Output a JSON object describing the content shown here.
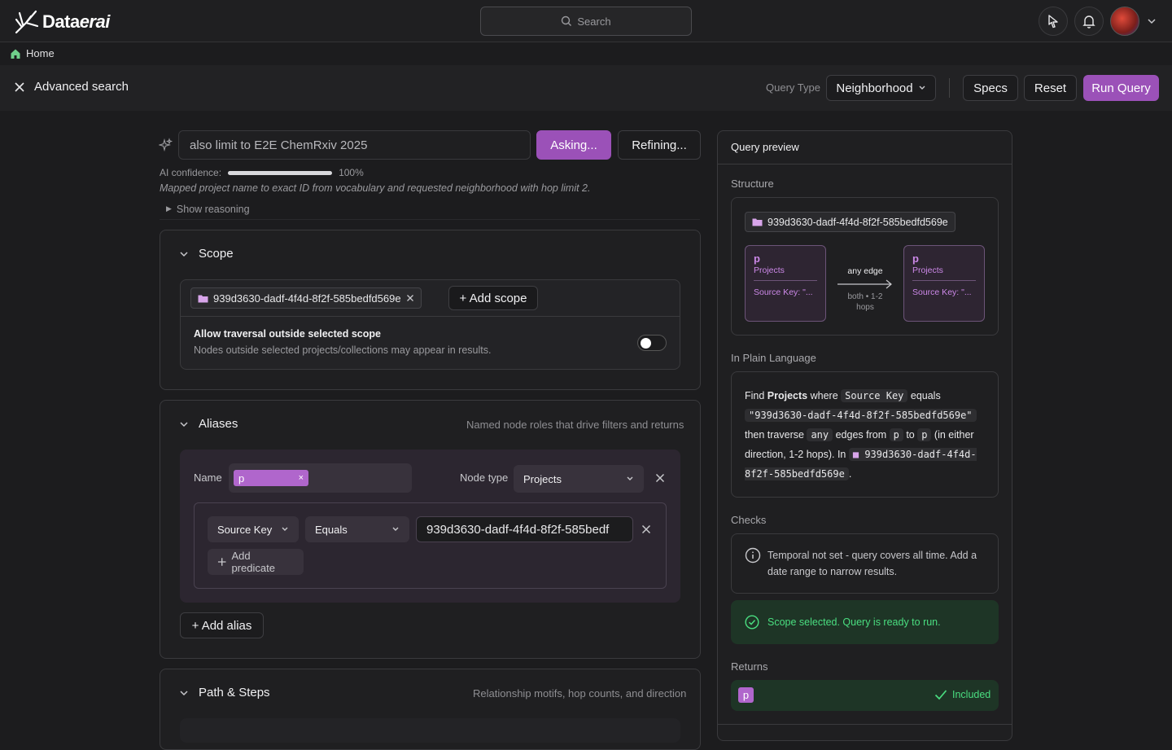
{
  "app": {
    "name_prefix": "Data",
    "name_suffix": "erai"
  },
  "search": {
    "placeholder": "Search"
  },
  "breadcrumb": {
    "home": "Home"
  },
  "page": {
    "title": "Advanced search"
  },
  "query_type": {
    "label": "Query Type",
    "value": "Neighborhood"
  },
  "actions": {
    "specs": "Specs",
    "reset": "Reset",
    "run": "Run Query"
  },
  "ai": {
    "prompt_value": "also limit to E2E ChemRxiv 2025",
    "asking": "Asking...",
    "refining": "Refining...",
    "confidence_label": "AI confidence:",
    "confidence_value": "100%",
    "confidence_fraction": 1.0,
    "mapped_note": "Mapped project name to exact ID from vocabulary and requested neighborhood with hop limit 2.",
    "show_reasoning": "Show reasoning"
  },
  "scope": {
    "title": "Scope",
    "chip": "939d3630-dadf-4f4d-8f2f-585bedfd569e",
    "add_scope": "+ Add scope",
    "traversal_title": "Allow traversal outside selected scope",
    "traversal_desc": "Nodes outside selected projects/collections may appear in results.",
    "traversal_on": false
  },
  "aliases": {
    "title": "Aliases",
    "subtitle": "Named node roles that drive filters and returns",
    "name_label": "Name",
    "name_value": "p",
    "node_type_label": "Node type",
    "node_type_value": "Projects",
    "predicate_field": "Source Key",
    "predicate_op": "Equals",
    "predicate_value": "939d3630-dadf-4f4d-8f2f-585bedf",
    "add_predicate": "Add predicate",
    "add_alias": "+ Add alias"
  },
  "path": {
    "title": "Path & Steps",
    "subtitle": "Relationship motifs, hop counts, and direction"
  },
  "preview": {
    "title": "Query preview",
    "structure_label": "Structure",
    "scope_chip": "939d3630-dadf-4f4d-8f2f-585bedfd569e",
    "node_a": {
      "alias": "p",
      "type": "Projects",
      "filter": "Source Key: \"..."
    },
    "node_b": {
      "alias": "p",
      "type": "Projects",
      "filter": "Source Key: \"..."
    },
    "edge_label": "any edge",
    "edge_sub1": "both • 1-2",
    "edge_sub2": "hops",
    "plain_label": "In Plain Language",
    "plain": {
      "t1": "Find ",
      "t2": "Projects",
      "t3": " where ",
      "c1": "Source Key",
      "t4": " equals",
      "c2": "\"939d3630-dadf-4f4d-8f2f-585bedfd569e\"",
      "t5": "then traverse ",
      "c3": "any",
      "t6": " edges from ",
      "c4": "p",
      "t7": " to ",
      "c5": "p",
      "t8": " (in either direction, 1-2 hops). In",
      "c6": "939d3630-dadf-4f4d-8f2f-585bedfd569e",
      "t9": "."
    },
    "checks_label": "Checks",
    "check_warn": "Temporal not set - query covers all time. Add a date range to narrow results.",
    "check_ok": "Scope selected. Query is ready to run.",
    "returns_label": "Returns",
    "return_alias": "p",
    "return_status": "Included"
  },
  "colors": {
    "accent": "#9b51b8",
    "alias": "#b066cc",
    "success": "#4ade80"
  }
}
